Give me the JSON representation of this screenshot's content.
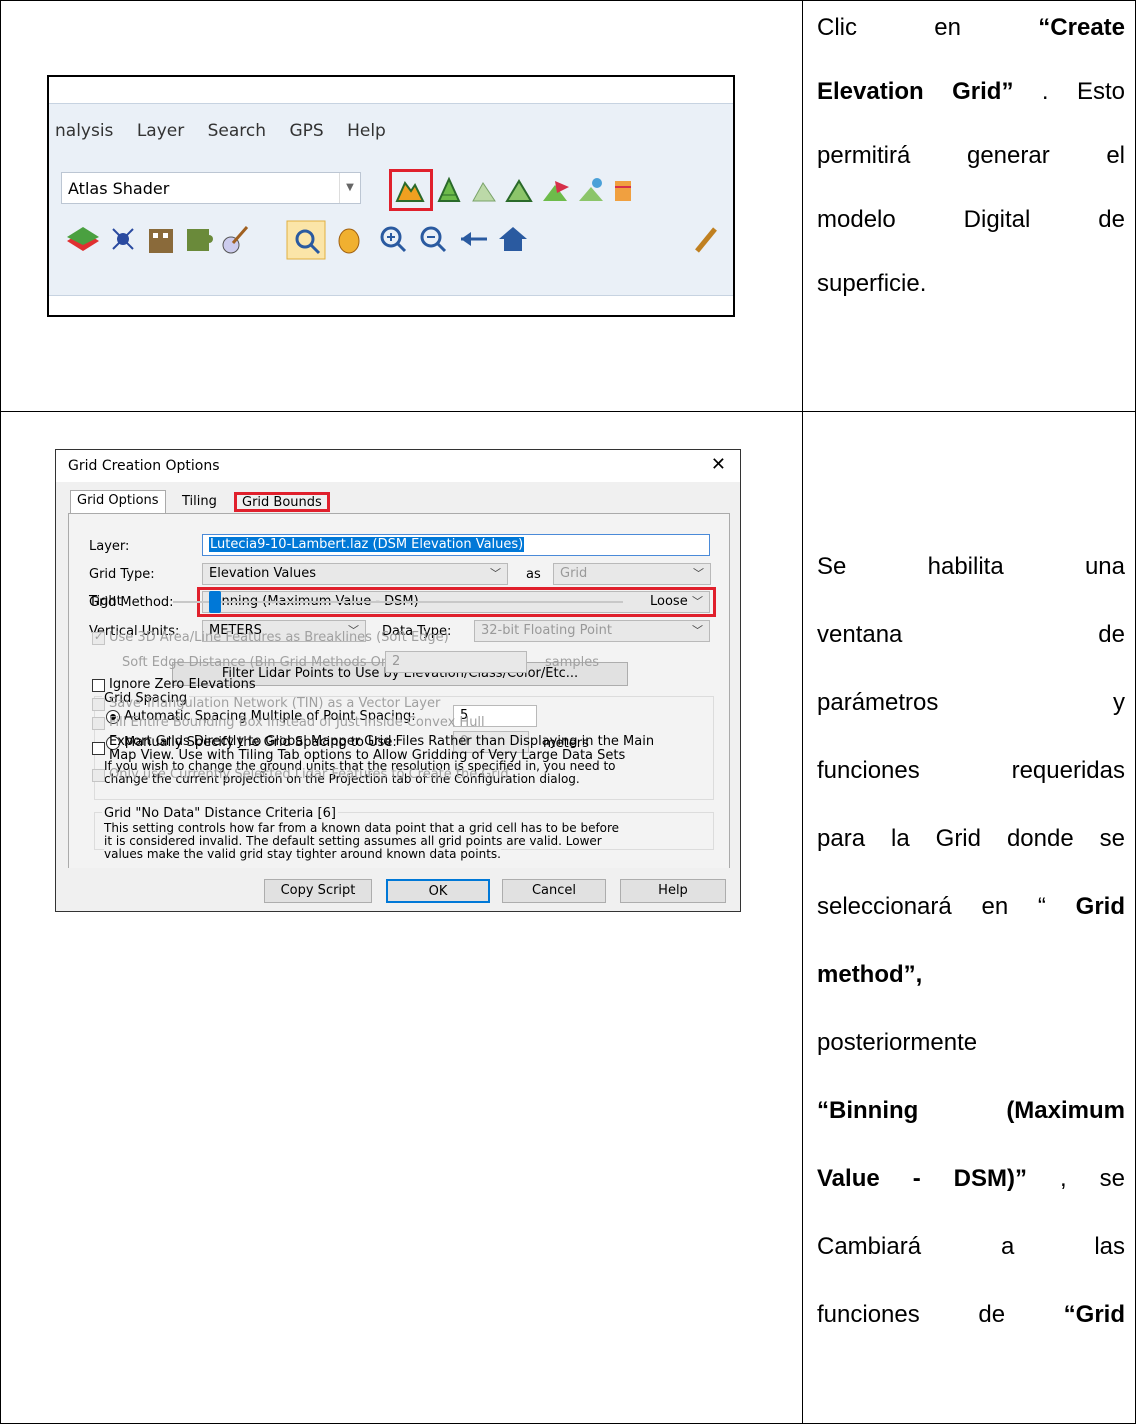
{
  "row1": {
    "menubar": [
      "nalysis",
      "Layer",
      "Search",
      "GPS",
      "Help"
    ],
    "shader_combo": "Atlas Shader",
    "text_lines": [
      {
        "parts": [
          {
            "t": "Clic"
          },
          {
            "t": "en"
          },
          {
            "t": "“Create",
            "b": true
          }
        ]
      },
      {
        "parts": [
          {
            "t": "Elevation Grid”",
            "b": true
          },
          {
            "t": ". Esto"
          }
        ]
      },
      {
        "parts": [
          {
            "t": "permitirá"
          },
          {
            "t": "generar"
          },
          {
            "t": "el"
          }
        ]
      },
      {
        "parts": [
          {
            "t": "modelo"
          },
          {
            "t": "Digital"
          },
          {
            "t": "de"
          }
        ]
      },
      {
        "parts": [
          {
            "t": "superficie."
          }
        ],
        "left": true
      }
    ]
  },
  "row2": {
    "dialog": {
      "title": "Grid Creation Options",
      "close": "✕",
      "tabs": [
        "Grid Options",
        "Tiling",
        "Grid Bounds"
      ],
      "layer_label": "Layer:",
      "layer_value": "Lutecia9-10-Lambert.laz (DSM Elevation Values)",
      "grid_type_label": "Grid Type:",
      "grid_type_value": "Elevation Values",
      "as_label": "as",
      "as_value": "Grid",
      "grid_method_label": "Grid Method:",
      "grid_method_value": "Binning (Maximum Value - DSM)",
      "vertical_units_label": "Vertical Units:",
      "vertical_units_value": "METERS",
      "data_type_label": "Data Type:",
      "data_type_value": "32-bit Floating Point",
      "filter_button": "Filter Lidar Points to Use by Elevation/Class/Color/Etc...",
      "grid_spacing_title": "Grid Spacing",
      "auto_spacing_label": "Automatic Spacing Multiple of Point Spacing:",
      "auto_spacing_value": "5",
      "manual_spacing_label": "Manually Specify the Grid Spacing to Use:",
      "manual_spacing_value": "0",
      "meters": "meters",
      "units_note_1": "If you wish to change the ground units that the resolution is specified in, you need to",
      "units_note_2": "change the current projection on the Projection tab of the Configuration dialog.",
      "nodata_title": "Grid \"No Data\" Distance Criteria [6]",
      "nodata_note_1": "This setting controls how far from a known data point that a grid cell has to be before",
      "nodata_note_2": "it is considered invalid. The default setting assumes all grid points are valid. Lower",
      "nodata_note_3": "values make the valid grid stay tighter around known data points.",
      "tight": "Tight",
      "loose": "Loose",
      "slider_level": 0.08,
      "use3d": "Use 3D Area/Line Features as Breaklines (Soft Edge)",
      "soft_edge_label": "Soft Edge Distance (Bin Grid Methods Only):",
      "soft_edge_value": "2",
      "samples": "samples",
      "ignore_zero": "Ignore Zero Elevations",
      "save_tin": "Save Triangulation Network (TIN) as a Vector Layer",
      "fill_bbox": "Fill Entire Bounding Box Instead of Just Inside Convex Hull",
      "export_1": "Export Grids Directly to Global Mapper Grid Files Rather than Displaying in the Main",
      "export_2": "Map View. Use with Tiling Tab options to Allow Gridding of Very Large Data Sets",
      "only_selected": "Only use Currently Selected Lidar Features to Create the Grid",
      "buttons": [
        "Copy Script",
        "OK",
        "Cancel",
        "Help"
      ]
    },
    "text_lines": [
      {
        "parts": [
          {
            "t": "Se"
          },
          {
            "t": "habilita"
          },
          {
            "t": "una"
          }
        ]
      },
      {
        "parts": [
          {
            "t": "ventana"
          },
          {
            "t": "de"
          }
        ]
      },
      {
        "parts": [
          {
            "t": "parámetros"
          },
          {
            "t": "y"
          }
        ]
      },
      {
        "parts": [
          {
            "t": "funciones"
          },
          {
            "t": "requeridas"
          }
        ]
      },
      {
        "parts": [
          {
            "t": "para la Grid donde se"
          }
        ]
      },
      {
        "parts": [
          {
            "t": "seleccionará en “"
          },
          {
            "t": "Grid",
            "b": true
          }
        ]
      },
      {
        "parts": [
          {
            "t": "method”,",
            "b": true
          }
        ],
        "left": true
      },
      {
        "parts": [
          {
            "t": "posteriormente"
          }
        ],
        "left": true
      },
      {
        "parts": [
          {
            "t": "“Binning",
            "b": true
          },
          {
            "t": "(Maximum",
            "b": true
          }
        ]
      },
      {
        "parts": [
          {
            "t": "Value - DSM)”",
            "b": true
          },
          {
            "t": ", se"
          }
        ]
      },
      {
        "parts": [
          {
            "t": "Cambiará"
          },
          {
            "t": "a"
          },
          {
            "t": "las"
          }
        ]
      },
      {
        "parts": [
          {
            "t": "funciones"
          },
          {
            "t": "de"
          },
          {
            "t": "“Grid",
            "b": true
          }
        ]
      }
    ]
  },
  "colors": {
    "highlight": "#e0202c",
    "selection": "#0078d7"
  }
}
